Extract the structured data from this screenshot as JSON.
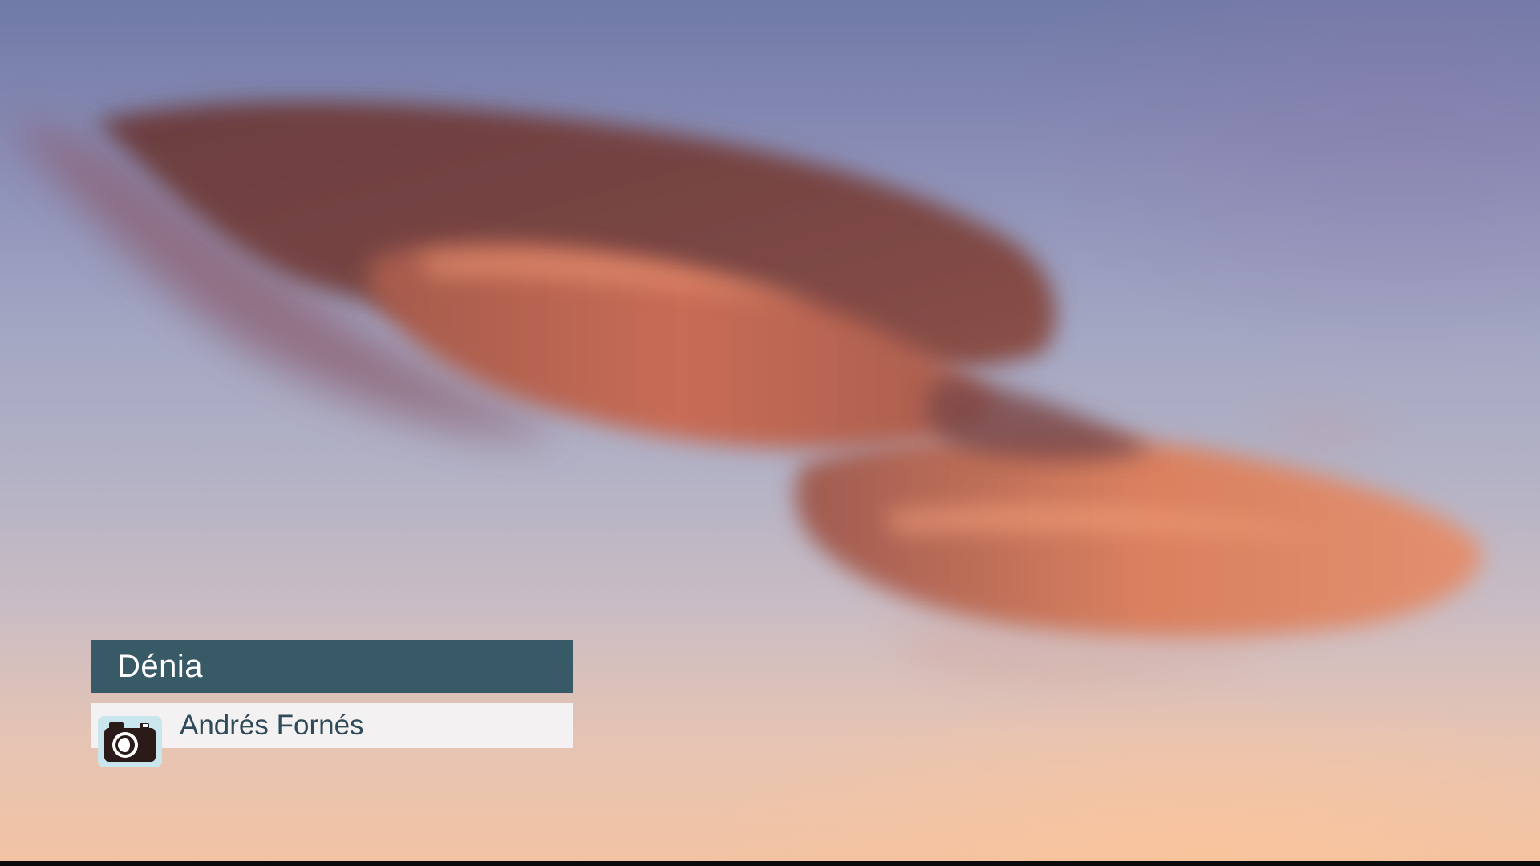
{
  "caption": {
    "location": "Dénia",
    "photographer": "Andrés Fornés"
  },
  "icons": {
    "photographer_icon": "camera-icon"
  },
  "colors": {
    "title_bg": "#385a66",
    "credit_bg": "#f5f4f6",
    "credit_text": "#2f4a58",
    "cloud_dark": "#6e3e3a",
    "cloud_glow": "#e4876a"
  }
}
